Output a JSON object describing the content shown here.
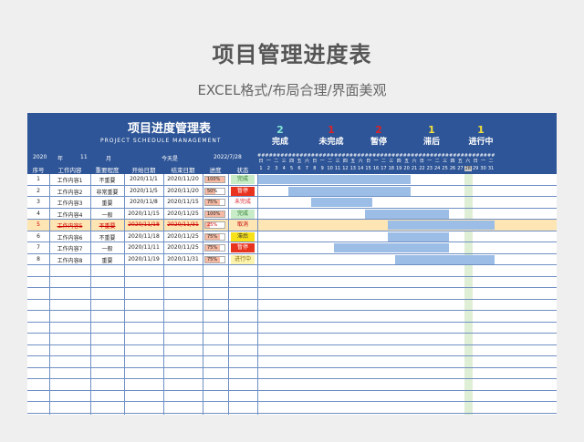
{
  "page": {
    "title": "项目管理进度表",
    "subtitle": "EXCEL格式/布局合理/界面美观"
  },
  "sheet": {
    "title": "项目进度管理表",
    "subtitle": "PROJECT SCHEDULE MANAGEMENT",
    "year": "2020",
    "year_label": "年",
    "month": "11",
    "month_label": "月",
    "today_label": "今天是",
    "today": "2022/7/28",
    "legend": [
      {
        "num": "2",
        "label": "完成",
        "color": "#7fe3d2"
      },
      {
        "num": "1",
        "label": "未完成",
        "color": "#d9232a"
      },
      {
        "num": "2",
        "label": "暂停",
        "color": "#d9232a"
      },
      {
        "num": "1",
        "label": "滞后",
        "color": "#f4e13c"
      },
      {
        "num": "1",
        "label": "进行中",
        "color": "#f4e13c"
      }
    ],
    "headers": [
      "序号",
      "工作内容",
      "重要程度",
      "开始日期",
      "结束日期",
      "进度",
      "状态"
    ],
    "day_top": "##",
    "weekdays": [
      "日",
      "一",
      "二",
      "三",
      "四",
      "五",
      "六",
      "日",
      "一",
      "二",
      "三",
      "四",
      "五",
      "六",
      "日",
      "一",
      "二",
      "三",
      "四",
      "五",
      "六",
      "日",
      "一",
      "二",
      "三",
      "四",
      "五",
      "六",
      "日",
      "一",
      "二"
    ],
    "dates": [
      "1",
      "2",
      "3",
      "4",
      "5",
      "6",
      "7",
      "8",
      "9",
      "10",
      "11",
      "12",
      "13",
      "14",
      "15",
      "16",
      "17",
      "18",
      "19",
      "20",
      "21",
      "22",
      "23",
      "24",
      "25",
      "26",
      "27",
      "28",
      "29",
      "30",
      "31"
    ],
    "rows": [
      {
        "no": "1",
        "task": "工作内容1",
        "priority": "不重要",
        "start": "2020/11/1",
        "end": "2020/11/20",
        "progress": "100%",
        "pct": 100,
        "status": "完成",
        "status_bg": "#c8ecc8",
        "status_fg": "#2a7a2a",
        "bar_start": 1,
        "bar_end": 20
      },
      {
        "no": "2",
        "task": "工作内容2",
        "priority": "非常重要",
        "start": "2020/11/5",
        "end": "2020/11/20",
        "progress": "50%",
        "pct": 50,
        "status": "暂停",
        "status_bg": "#e8331f",
        "status_fg": "#ffffff",
        "bar_start": 5,
        "bar_end": 20
      },
      {
        "no": "3",
        "task": "工作内容3",
        "priority": "重要",
        "start": "2020/11/8",
        "end": "2020/11/15",
        "progress": "75%",
        "pct": 75,
        "status": "未完成",
        "status_bg": "#ffffff",
        "status_fg": "#d9232a",
        "bar_start": 8,
        "bar_end": 15
      },
      {
        "no": "4",
        "task": "工作内容4",
        "priority": "一般",
        "start": "2020/11/15",
        "end": "2020/11/25",
        "progress": "100%",
        "pct": 100,
        "status": "完成",
        "status_bg": "#c8ecc8",
        "status_fg": "#2a7a2a",
        "bar_start": 15,
        "bar_end": 25
      },
      {
        "no": "5",
        "task": "工作内容5",
        "priority": "不重要",
        "start": "2020/11/18",
        "end": "2020/11/31",
        "progress": "25%",
        "pct": 25,
        "status": "取消",
        "status_bg": "#fde5b4",
        "status_fg": "#c00000",
        "bar_start": 18,
        "bar_end": 31,
        "cancel": true
      },
      {
        "no": "6",
        "task": "工作内容6",
        "priority": "不重要",
        "start": "2020/11/18",
        "end": "2020/11/25",
        "progress": "75%",
        "pct": 75,
        "status": "滞后",
        "status_bg": "#f7e21a",
        "status_fg": "#333333",
        "bar_start": 18,
        "bar_end": 25
      },
      {
        "no": "7",
        "task": "工作内容7",
        "priority": "一般",
        "start": "2020/11/11",
        "end": "2020/11/25",
        "progress": "75%",
        "pct": 75,
        "status": "暂停",
        "status_bg": "#e8331f",
        "status_fg": "#ffffff",
        "bar_start": 11,
        "bar_end": 25
      },
      {
        "no": "8",
        "task": "工作内容8",
        "priority": "重要",
        "start": "2020/11/19",
        "end": "2020/11/31",
        "progress": "75%",
        "pct": 75,
        "status": "进行中",
        "status_bg": "#fdf4b0",
        "status_fg": "#8a6a00",
        "bar_start": 19,
        "bar_end": 31
      }
    ],
    "empty_rows": 13,
    "today_day": 28,
    "colors": {
      "header": "#2e5597",
      "bar": "#9cbde6",
      "grid": "#6f8fc4",
      "today": "#dfefd6"
    }
  }
}
